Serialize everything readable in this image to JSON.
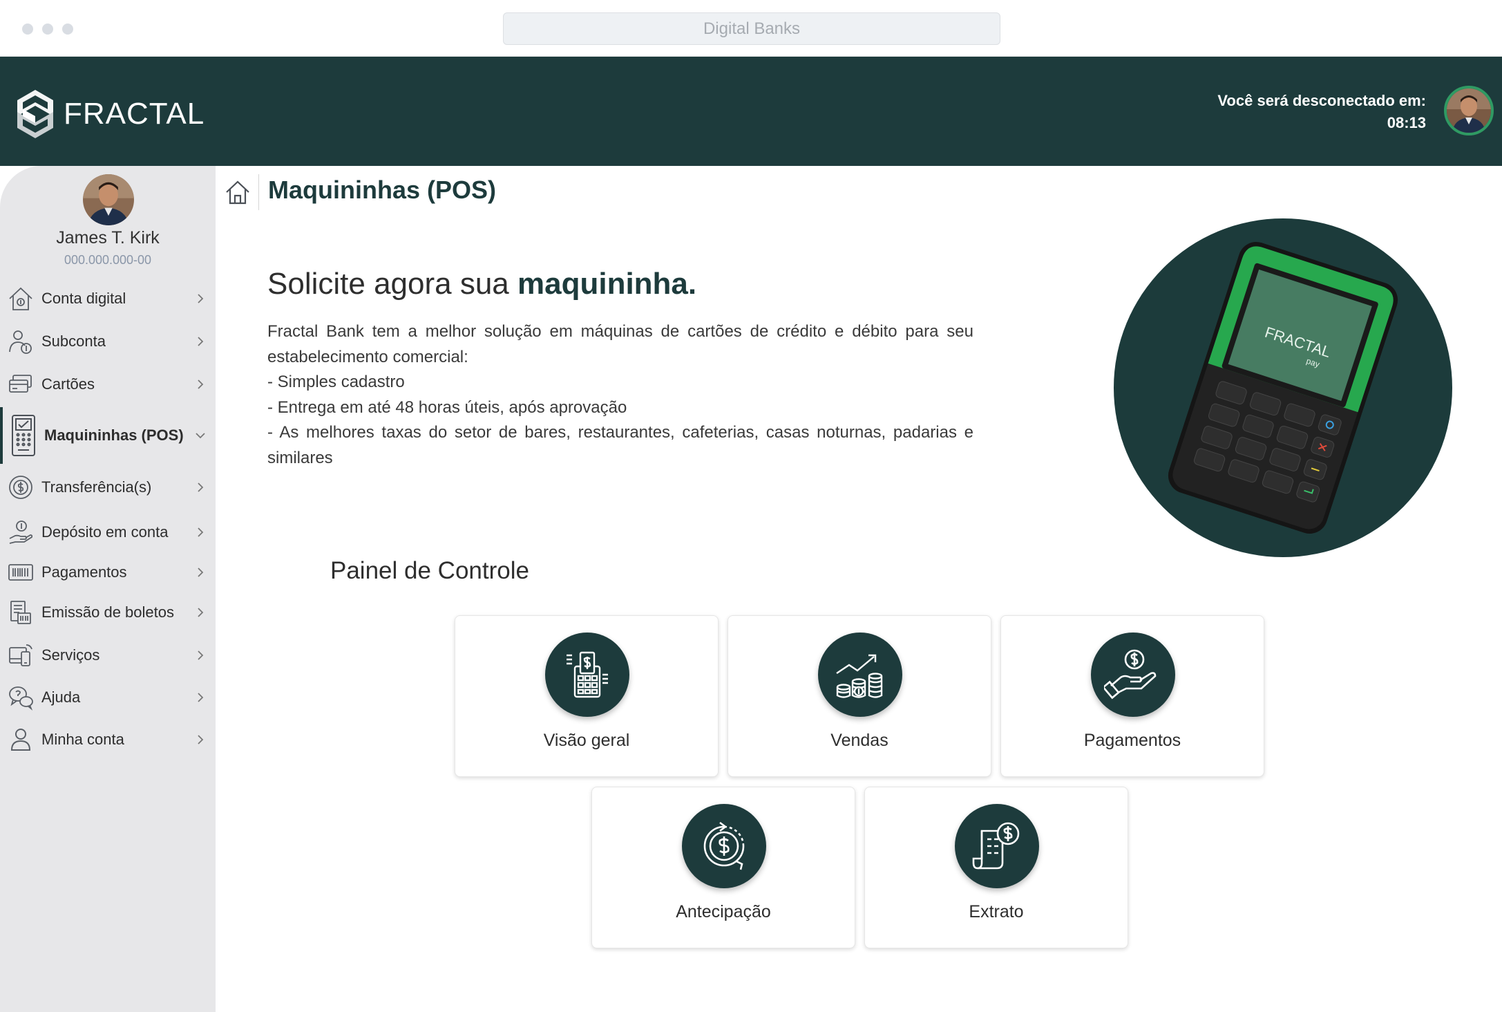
{
  "browser": {
    "url_text": "Digital Banks"
  },
  "header": {
    "brand": "FRACTAL",
    "logout_label": "Você será desconectado em:",
    "logout_time": "08:13"
  },
  "user": {
    "name": "James T. Kirk",
    "document": "000.000.000-00"
  },
  "sidebar": {
    "items": [
      {
        "label": "Conta digital",
        "icon": "home-money-icon"
      },
      {
        "label": "Subconta",
        "icon": "user-coin-icon"
      },
      {
        "label": "Cartões",
        "icon": "cards-icon"
      },
      {
        "label": "Maquininhas (POS)",
        "icon": "pos-terminal-icon",
        "active": true
      },
      {
        "label": "Transferência(s)",
        "icon": "transfer-coin-icon"
      },
      {
        "label": "Depósito em conta",
        "icon": "deposit-hand-icon"
      },
      {
        "label": "Pagamentos",
        "icon": "barcode-icon"
      },
      {
        "label": "Emissão de boletos",
        "icon": "boleto-icon"
      },
      {
        "label": "Serviços",
        "icon": "services-phone-icon"
      },
      {
        "label": "Ajuda",
        "icon": "help-chat-icon"
      },
      {
        "label": "Minha conta",
        "icon": "user-icon"
      }
    ]
  },
  "page": {
    "title": "Maquininhas (POS)"
  },
  "promo": {
    "title_prefix": "Solicite agora sua ",
    "title_emphasis": "maquininha.",
    "description": "Fractal Bank tem a melhor solução em máquinas de cartões de crédito e débito para seu estabelecimento comercial:",
    "bullets": [
      "- Simples cadastro",
      "- Entrega em até 48 horas úteis, após aprovação",
      "- As melhores taxas do setor de bares, restaurantes, cafeterias, casas noturnas, padarias e similares"
    ],
    "device_brand": "FRACTAL",
    "device_sub": "pay"
  },
  "panel": {
    "title": "Painel de Controle",
    "cards": [
      {
        "label": "Visão geral",
        "icon": "pos-overview-icon"
      },
      {
        "label": "Vendas",
        "icon": "sales-growth-icon"
      },
      {
        "label": "Pagamentos",
        "icon": "hand-dollar-icon"
      },
      {
        "label": "Antecipação",
        "icon": "dollar-cycle-icon"
      },
      {
        "label": "Extrato",
        "icon": "statement-dollar-icon"
      }
    ]
  },
  "colors": {
    "brand_dark": "#1d3b3c",
    "accent_green": "#2f9a63",
    "sidebar_bg": "#e7e7e9"
  }
}
